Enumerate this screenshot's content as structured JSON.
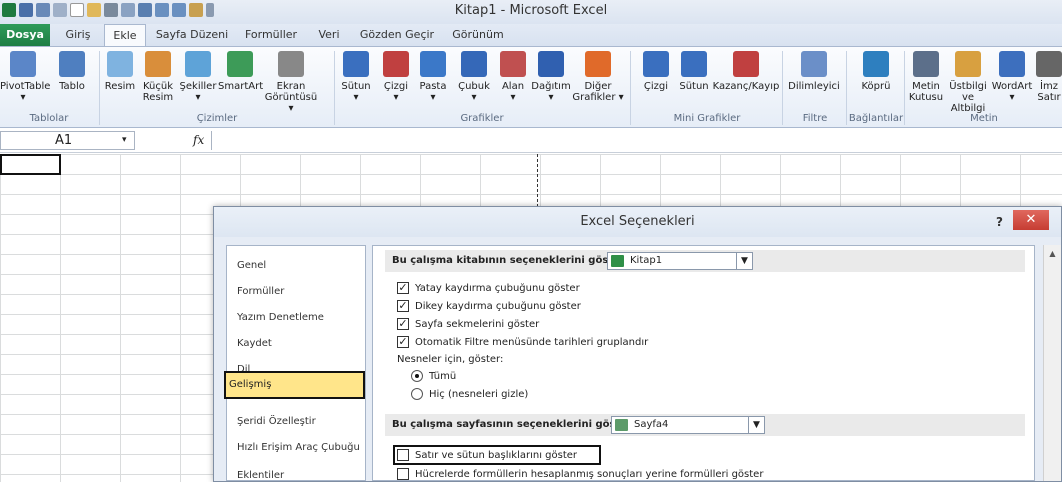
{
  "window": {
    "title": "Kitap1 - Microsoft Excel"
  },
  "tabs": [
    "Dosya",
    "Giriş",
    "Ekle",
    "Sayfa Düzeni",
    "Formüller",
    "Veri",
    "Gözden Geçir",
    "Görünüm"
  ],
  "ribbon": {
    "buttons": [
      {
        "label": "PivotTable",
        "sub": "▾",
        "icon": "pivottable-icon",
        "color": "#5b86c8"
      },
      {
        "label": "Tablo",
        "sub": "",
        "icon": "table-icon",
        "color": "#4f7fc0"
      },
      {
        "label": "Resim",
        "sub": "",
        "icon": "picture-icon",
        "color": "#7fb3e0"
      },
      {
        "label": "Küçük",
        "sub": "Resim",
        "icon": "clipart-icon",
        "color": "#d98e3b"
      },
      {
        "label": "Şekiller",
        "sub": "▾",
        "icon": "shapes-icon",
        "color": "#5ea3d8"
      },
      {
        "label": "SmartArt",
        "sub": "",
        "icon": "smartart-icon",
        "color": "#3d9b58"
      },
      {
        "label": "Ekran",
        "sub": "Görüntüsü ▾",
        "icon": "screenshot-icon",
        "color": "#888888"
      },
      {
        "label": "Sütun",
        "sub": "▾",
        "icon": "column-chart-icon",
        "color": "#3a6fbf"
      },
      {
        "label": "Çizgi",
        "sub": "▾",
        "icon": "line-chart-icon",
        "color": "#c04040"
      },
      {
        "label": "Pasta",
        "sub": "▾",
        "icon": "pie-chart-icon",
        "color": "#3b78c8"
      },
      {
        "label": "Çubuk",
        "sub": "▾",
        "icon": "bar-chart-icon",
        "color": "#3568b8"
      },
      {
        "label": "Alan",
        "sub": "▾",
        "icon": "area-chart-icon",
        "color": "#c05050"
      },
      {
        "label": "Dağıtım",
        "sub": "▾",
        "icon": "scatter-chart-icon",
        "color": "#3060b0"
      },
      {
        "label": "Diğer",
        "sub": "Grafikler ▾",
        "icon": "other-charts-icon",
        "color": "#e06a2a"
      },
      {
        "label": "Çizgi",
        "sub": "",
        "icon": "sparkline-line-icon",
        "color": "#3a6fbf"
      },
      {
        "label": "Sütun",
        "sub": "",
        "icon": "sparkline-column-icon",
        "color": "#3a6fbf"
      },
      {
        "label": "Kazanç/Kayıp",
        "sub": "",
        "icon": "sparkline-winloss-icon",
        "color": "#c04040"
      },
      {
        "label": "Dilimleyici",
        "sub": "",
        "icon": "slicer-icon",
        "color": "#6b8fc8"
      },
      {
        "label": "Köprü",
        "sub": "",
        "icon": "hyperlink-icon",
        "color": "#2e7fbf"
      },
      {
        "label": "Metin",
        "sub": "Kutusu",
        "icon": "textbox-icon",
        "color": "#5c6f8a"
      },
      {
        "label": "Üstbilgi",
        "sub": "ve Altbilgi",
        "icon": "header-footer-icon",
        "color": "#d8a040"
      },
      {
        "label": "WordArt",
        "sub": "▾",
        "icon": "wordart-icon",
        "color": "#3d6fbe"
      },
      {
        "label": "İmz",
        "sub": "Satır",
        "icon": "signature-icon",
        "color": "#666666"
      }
    ],
    "groups": [
      "Tablolar",
      "Çizimler",
      "Grafikler",
      "Mini Grafikler",
      "Filtre",
      "Bağlantılar",
      "Metin"
    ]
  },
  "formula_bar": {
    "name_box": "A1",
    "fx": "fx"
  },
  "dialog": {
    "title": "Excel Seçenekleri",
    "help": "?",
    "close": "✕",
    "nav": [
      "Genel",
      "Formüller",
      "Yazım Denetleme",
      "Kaydet",
      "Dil",
      "Gelişmiş",
      "Şeridi Özelleştir",
      "Hızlı Erişim Araç Çubuğu",
      "Eklentiler"
    ],
    "workbook_section": {
      "label": "Bu çalışma kitabının seçeneklerini göster:",
      "value": "Kitap1"
    },
    "workbook_options": [
      {
        "label": "Yatay kaydırma çubuğunu göster",
        "checked": true
      },
      {
        "label": "Dikey kaydırma çubuğunu göster",
        "checked": true
      },
      {
        "label": "Sayfa sekmelerini göster",
        "checked": true
      },
      {
        "label": "Otomatik Filtre menüsünde tarihleri gruplandır",
        "checked": true
      }
    ],
    "objects_label": "Nesneler için, göster:",
    "objects_options": [
      {
        "label": "Tümü",
        "selected": true
      },
      {
        "label": "Hiç (nesneleri gizle)",
        "selected": false
      }
    ],
    "sheet_section": {
      "label": "Bu çalışma sayfasının seçeneklerini göster:",
      "value": "Sayfa4"
    },
    "sheet_options": [
      {
        "label": "Satır ve sütun başlıklarını göster",
        "checked": false
      },
      {
        "label": "Hücrelerde formüllerin hesaplanmış sonuçları yerine formülleri göster",
        "checked": false
      }
    ]
  }
}
